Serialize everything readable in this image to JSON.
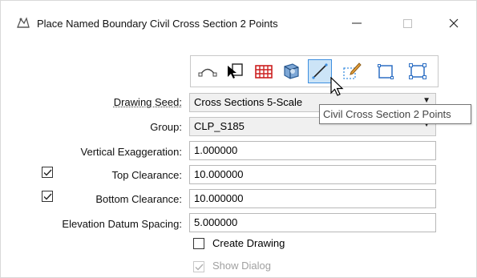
{
  "window": {
    "title": "Place Named Boundary Civil Cross Section 2 Points",
    "icon": "place-boundary-icon",
    "buttons": {
      "minimize": "—",
      "maximize": "□",
      "close": "✕"
    }
  },
  "toolbar": {
    "tools": [
      {
        "name": "civil-plan-tool-icon",
        "selected": false
      },
      {
        "name": "place-view-cursor-icon",
        "selected": false
      },
      {
        "name": "grid-table-icon",
        "selected": false
      },
      {
        "name": "3d-model-icon",
        "selected": false
      },
      {
        "name": "civil-cross-section-2-points-icon",
        "selected": true
      },
      {
        "name": "pencil-dashed-box-icon",
        "selected": false
      },
      {
        "name": "square-boundary-icon",
        "selected": false
      },
      {
        "name": "rectangle-corners-icon",
        "selected": false
      }
    ],
    "tooltip": "Civil Cross Section 2 Points"
  },
  "form": {
    "drawing_seed": {
      "label": "Drawing Seed:",
      "value": "Cross Sections 5-Scale"
    },
    "group": {
      "label": "Group:",
      "value": "CLP_S185"
    },
    "vertical_exaggeration": {
      "label": "Vertical Exaggeration:",
      "value": "1.000000"
    },
    "top_clearance": {
      "label": "Top Clearance:",
      "value": "10.000000",
      "checked": true
    },
    "bottom_clearance": {
      "label": "Bottom Clearance:",
      "value": "10.000000",
      "checked": true
    },
    "elevation_datum_spacing": {
      "label": "Elevation Datum Spacing:",
      "value": "5.000000"
    },
    "create_drawing": {
      "label": "Create Drawing",
      "checked": false
    },
    "show_dialog": {
      "label": "Show Dialog",
      "checked": true,
      "disabled": true
    }
  },
  "colors": {
    "accent": "#3d8fe0",
    "selection_bg": "#cce4f7",
    "disabled_text": "#a0a0a0"
  }
}
